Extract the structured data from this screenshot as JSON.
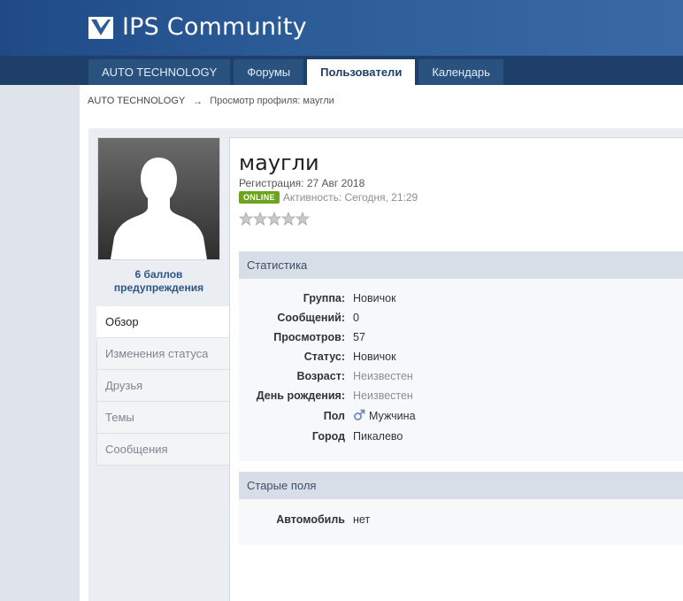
{
  "header": {
    "site_title": "IPS Community",
    "logo_icon": "ips-logo-icon",
    "brand_color": "#1f4a86"
  },
  "nav": {
    "tabs": [
      {
        "label": "AUTO TECHNOLOGY",
        "active": false
      },
      {
        "label": "Форумы",
        "active": false
      },
      {
        "label": "Пользователи",
        "active": true
      },
      {
        "label": "Календарь",
        "active": false
      }
    ]
  },
  "breadcrumb": {
    "home": "AUTO TECHNOLOGY",
    "separator": "→",
    "current": "Просмотр профиля: маугли"
  },
  "sidebar": {
    "avatar_icon": "default-avatar-silhouette",
    "warnings_line1": "6 баллов",
    "warnings_line2": "предупреждения",
    "items": [
      {
        "label": "Обзор",
        "active": true
      },
      {
        "label": "Изменения статуса",
        "active": false
      },
      {
        "label": "Друзья",
        "active": false
      },
      {
        "label": "Темы",
        "active": false
      },
      {
        "label": "Сообщения",
        "active": false
      }
    ]
  },
  "profile": {
    "username": "маугли",
    "joined": "Регистрация: 27 Авг 2018",
    "online_badge": "ONLINE",
    "activity": "Активность: Сегодня, 21:29",
    "rating_stars_filled": 0,
    "rating_stars_total": 5
  },
  "stats": {
    "title": "Статистика",
    "rows": [
      {
        "label": "Группа:",
        "value": "Новичок",
        "muted": false
      },
      {
        "label": "Сообщений:",
        "value": "0",
        "muted": false
      },
      {
        "label": "Просмотров:",
        "value": "57",
        "muted": false
      },
      {
        "label": "Статус:",
        "value": "Новичок",
        "muted": false
      },
      {
        "label": "Возраст:",
        "value": "Неизвестен",
        "muted": true
      },
      {
        "label": "День рождения:",
        "value": "Неизвестен",
        "muted": true
      },
      {
        "label": "Пол",
        "value": "Мужчина",
        "muted": false,
        "icon": "male-gender-icon"
      },
      {
        "label": "Город",
        "value": "Пикалево",
        "muted": false
      }
    ]
  },
  "old_fields": {
    "title": "Старые поля",
    "rows": [
      {
        "label": "Автомобиль",
        "value": "нет"
      }
    ]
  },
  "colors": {
    "online": "#6ca51d",
    "section_head": "#d7dee8",
    "nav_bg": "#1d3f6a"
  }
}
